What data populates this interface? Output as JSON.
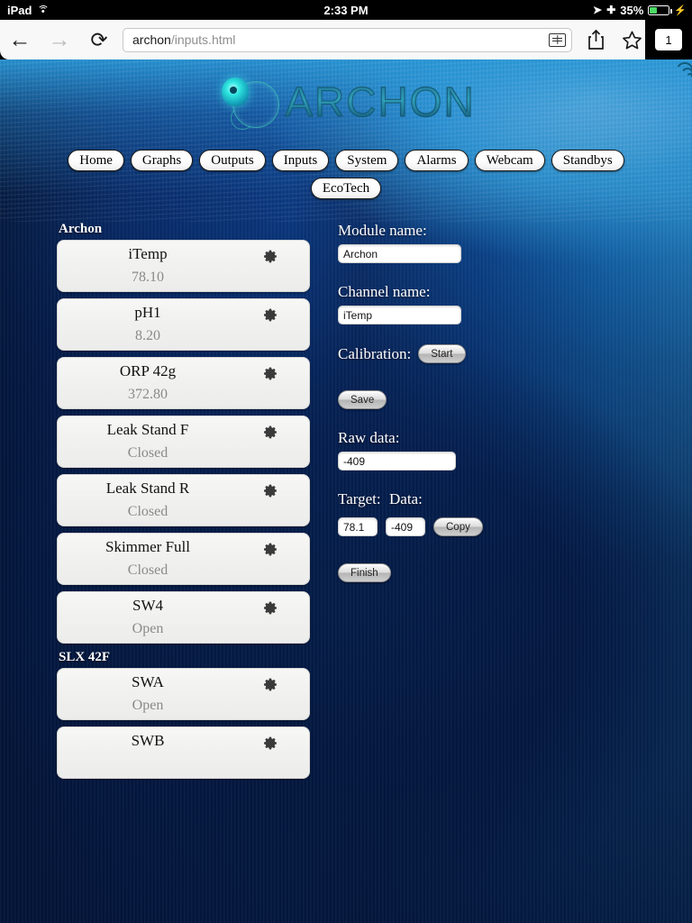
{
  "status_bar": {
    "carrier": "iPad",
    "wifi_icon": "wifi-icon",
    "time": "2:33 PM",
    "location_icon": "location-arrow-icon",
    "bluetooth_icon": "bluetooth-icon",
    "battery_percent": "35%",
    "battery_level": 35,
    "charging_icon": "lightning-bolt-icon"
  },
  "browser": {
    "back_icon": "back-arrow-icon",
    "forward_icon": "forward-arrow-icon",
    "reload_icon": "reload-icon",
    "url_host": "archon",
    "url_path": "/inputs.html",
    "reader_icon": "reader-view-icon",
    "share_icon": "share-icon",
    "bookmark_icon": "bookmark-star-icon",
    "tab_count": "1"
  },
  "brand": {
    "logo_text": "ARCHON",
    "logo_mark": "archon-spiral-logo",
    "signal_icon": "wifi-signal-icon"
  },
  "nav": {
    "row1": [
      {
        "label": "Home"
      },
      {
        "label": "Graphs"
      },
      {
        "label": "Outputs"
      },
      {
        "label": "Inputs"
      },
      {
        "label": "System"
      },
      {
        "label": "Alarms"
      },
      {
        "label": "Webcam"
      },
      {
        "label": "Standbys"
      }
    ],
    "row2": [
      {
        "label": "EcoTech"
      }
    ]
  },
  "channel_groups": [
    {
      "title": "Archon",
      "channels": [
        {
          "name": "iTemp",
          "value": "78.10"
        },
        {
          "name": "pH1",
          "value": "8.20"
        },
        {
          "name": "ORP 42g",
          "value": "372.80"
        },
        {
          "name": "Leak Stand F",
          "value": "Closed"
        },
        {
          "name": "Leak Stand R",
          "value": "Closed"
        },
        {
          "name": "Skimmer Full",
          "value": "Closed"
        },
        {
          "name": "SW4",
          "value": "Open"
        }
      ]
    },
    {
      "title": "SLX 42F",
      "channels": [
        {
          "name": "SWA",
          "value": "Open"
        },
        {
          "name": "SWB",
          "value": ""
        }
      ]
    }
  ],
  "form": {
    "module_label": "Module name:",
    "module_value": "Archon",
    "channel_label": "Channel name:",
    "channel_value": "iTemp",
    "calibration_label": "Calibration:",
    "start_label": "Start",
    "save_label": "Save",
    "raw_label": "Raw data:",
    "raw_value": "-409",
    "target_label": "Target:",
    "data_label": "Data:",
    "target_value": "78.1",
    "data_value": "-409",
    "copy_label": "Copy",
    "finish_label": "Finish"
  },
  "colors": {
    "ocean_light": "#2a9ad8",
    "ocean_deep": "#062350",
    "card_bg": "#f1f1f0",
    "value_text": "#8a8a8a",
    "battery_green": "#4cd964"
  }
}
